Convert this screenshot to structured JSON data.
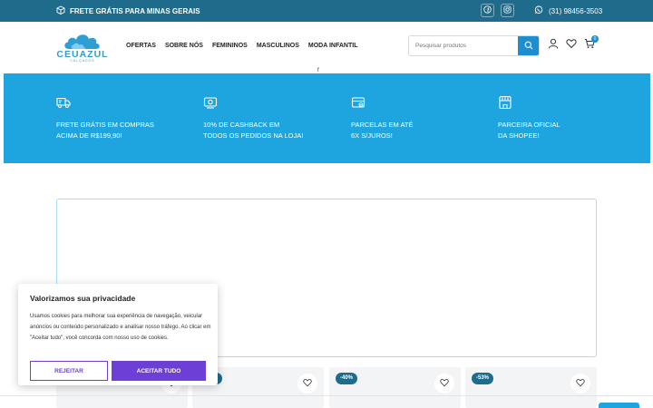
{
  "topbar": {
    "promo_text": "FRETE GRÁTIS PARA MINAS GERAIS",
    "promo_icon": "box-icon",
    "social": [
      {
        "name": "facebook",
        "icon": "facebook-icon"
      },
      {
        "name": "instagram",
        "icon": "instagram-icon"
      }
    ],
    "phone": "(31) 98456-3503",
    "phone_icon": "whatsapp-icon"
  },
  "header": {
    "logo_text": "CEUAZUL",
    "logo_subtext": "CALÇADOS",
    "nav": [
      {
        "label": "OFERTAS"
      },
      {
        "label": "SOBRE NÓS"
      },
      {
        "label": "FEMININOS"
      },
      {
        "label": "MASCULINOS"
      },
      {
        "label": "MODA INFANTIL"
      }
    ],
    "search_placeholder": "Pesquisar produtos",
    "cart_count": "0",
    "mark": "f"
  },
  "benefits": [
    {
      "icon": "truck-icon",
      "line1": "FRETE GRÁTIS EM COMPRAS",
      "line2": "ACIMA DE R$199,90!"
    },
    {
      "icon": "cashback-icon",
      "line1": "10% DE CASHBACK EM",
      "line2": "TODOS OS PEDIDOS NA LOJA!"
    },
    {
      "icon": "card-icon",
      "line1": "PARCELAS EM ATÉ",
      "line2": "6X S/JUROS!"
    },
    {
      "icon": "store-icon",
      "line1": "PARCEIRA OFICIAL",
      "line2": "DA SHOPEE!"
    }
  ],
  "products": [
    {
      "discount": ""
    },
    {
      "discount": ""
    },
    {
      "discount": "-40%"
    },
    {
      "discount": "-53%"
    }
  ],
  "cookie": {
    "title": "Valorizamos sua privacidade",
    "text": "Usamos cookies para melhorar sua experiência de navegação, veicular anúncios ou conteúdo personalizado e analisar nosso tráfego. Ao clicar em \"Aceitar tudo\", você concorda com nosso uso de cookies.",
    "reject_label": "REJEITAR",
    "accept_label": "ACEITAR TUDO"
  },
  "colors": {
    "topbar": "#1f6b8c",
    "accent": "#1ea5e0",
    "search_button": "#1d8ed0",
    "cookie_button": "#6d3fd6"
  }
}
